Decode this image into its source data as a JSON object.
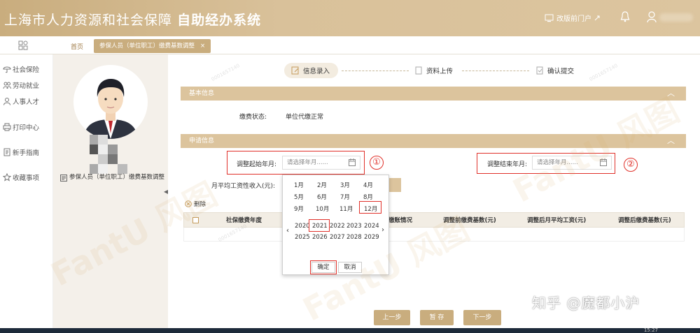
{
  "header": {
    "title_plain": "上海市人力资源和社会保障",
    "title_bold": "自助经办系统",
    "portal_label": "改版前门户"
  },
  "tabs": {
    "home": "首页",
    "active": "参保人员（单位职工）缴费基数调整",
    "close": "×"
  },
  "sidebar": {
    "items": [
      {
        "label": "社会保险",
        "icon": "umbrella-icon"
      },
      {
        "label": "劳动就业",
        "icon": "people-icon"
      },
      {
        "label": "人事人才",
        "icon": "person-icon"
      },
      {
        "label": "打印中心",
        "icon": "printer-icon"
      },
      {
        "label": "新手指南",
        "icon": "book-icon"
      },
      {
        "label": "收藏事项",
        "icon": "star-icon"
      }
    ]
  },
  "profile": {
    "label": "参保人员（单位职工）缴费基数调整"
  },
  "steps": [
    {
      "label": "信息录入",
      "active": true
    },
    {
      "label": "资料上传",
      "active": false
    },
    {
      "label": "确认提交",
      "active": false
    }
  ],
  "basic": {
    "title": "基本信息",
    "status_label": "缴费状态:",
    "status_value": "单位代缴正常"
  },
  "apply": {
    "title": "申请信息",
    "start_label": "调整起始年月:",
    "start_placeholder": "请选择年月......",
    "end_label": "调整结束年月:",
    "end_placeholder": "请选择年月......",
    "income_label": "月平均工资性收入(元):",
    "delete_label": "删除"
  },
  "annotations": {
    "one": "①",
    "two": "②"
  },
  "table": {
    "headers": [
      "社保缴费年度",
      "缴账情况",
      "调整前缴费基数(元)",
      "调整后月平均工资(元)",
      "调整后缴费基数(元)"
    ]
  },
  "picker": {
    "months": [
      "1月",
      "2月",
      "3月",
      "4月",
      "5月",
      "6月",
      "7月",
      "8月",
      "9月",
      "10月",
      "11月",
      "12月"
    ],
    "selected_month": "12月",
    "years": [
      "2020",
      "2021",
      "2022",
      "2023",
      "2024",
      "2025",
      "2026",
      "2027",
      "2028",
      "2029"
    ],
    "selected_year": "2021",
    "prev": "‹",
    "next": "›",
    "confirm": "确定",
    "cancel": "取消"
  },
  "footer": {
    "prev": "上一步",
    "save": "暂 存",
    "next": "下一步"
  },
  "watermark": {
    "zhihu": "知乎 @魔都小沪",
    "brand": "FantU 风图",
    "small": "0001657140"
  },
  "taskbar": {
    "time": "15:27"
  },
  "colors": {
    "accent": "#c9ad7e",
    "section": "#dcc49d",
    "highlight": "#e0312a"
  }
}
